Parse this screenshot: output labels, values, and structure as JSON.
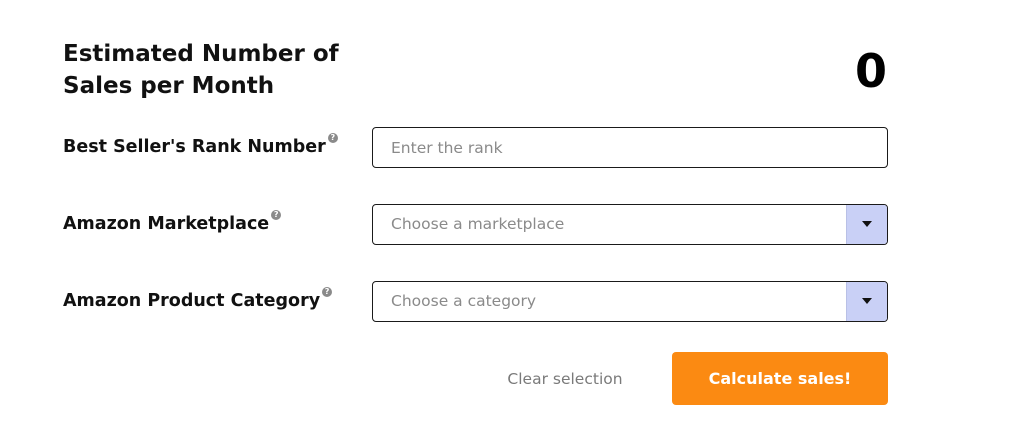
{
  "header": {
    "title_line1": "Estimated Number of",
    "title_line2": "Sales per Month",
    "result_value": "0"
  },
  "form": {
    "rank": {
      "label": "Best Seller's Rank Number",
      "help_icon": "question-circle-icon",
      "placeholder": "Enter the rank",
      "value": ""
    },
    "marketplace": {
      "label": "Amazon Marketplace",
      "help_icon": "question-circle-icon",
      "placeholder": "Choose a marketplace",
      "dropdown_icon": "caret-down-icon"
    },
    "category": {
      "label": "Amazon Product Category",
      "help_icon": "question-circle-icon",
      "placeholder": "Choose a category",
      "dropdown_icon": "caret-down-icon"
    }
  },
  "actions": {
    "clear_label": "Clear selection",
    "calculate_label": "Calculate sales!"
  },
  "colors": {
    "accent": "#fb8a12",
    "dropdown_button": "#c9d0f6",
    "text": "#111111",
    "muted": "#8a8a8a"
  }
}
